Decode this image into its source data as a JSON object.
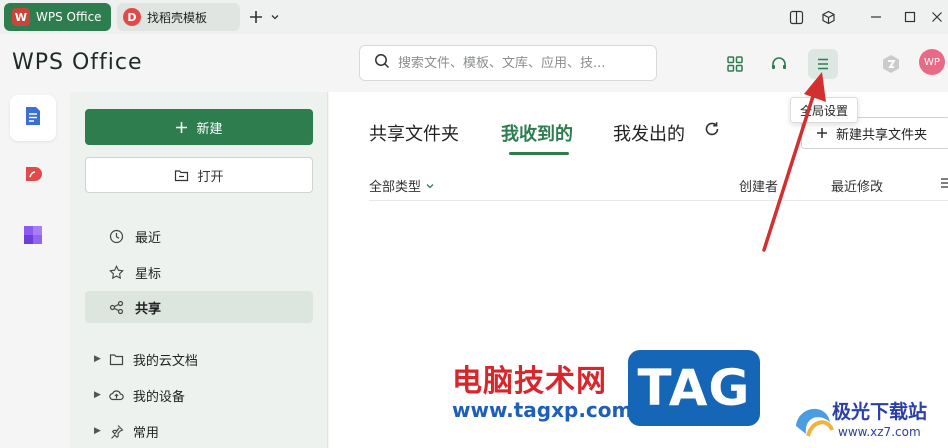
{
  "titlebar": {
    "tabs": [
      {
        "label": "WPS Office"
      },
      {
        "label": "找稻壳模板"
      }
    ]
  },
  "header": {
    "brand": "WPS Office",
    "search_placeholder": "搜索文件、模板、文库、应用、技...",
    "avatar_initials": "WP"
  },
  "tooltip": {
    "label": "全局设置"
  },
  "sidebar": {
    "new_label": "新建",
    "open_label": "打开",
    "nav": [
      {
        "label": "最近"
      },
      {
        "label": "星标"
      },
      {
        "label": "共享"
      }
    ],
    "tree": [
      {
        "label": "我的云文档"
      },
      {
        "label": "我的设备"
      },
      {
        "label": "常用"
      }
    ]
  },
  "main": {
    "tabs": [
      {
        "label": "共享文件夹"
      },
      {
        "label": "我收到的"
      },
      {
        "label": "我发出的"
      }
    ],
    "new_shared_label": "新建共享文件夹",
    "filter_label": "全部类型",
    "columns": {
      "creator": "创建者",
      "modified": "最近修改"
    }
  },
  "watermark": {
    "site_cn": "电脑技术网",
    "site_url": "www.tagxp.com",
    "badge": "TAG",
    "xz_cn": "极光下载站",
    "xz_url": "www.xz7.com"
  },
  "colors": {
    "accent": "#2e7d4f",
    "annotation_arrow": "#d32f2f"
  }
}
